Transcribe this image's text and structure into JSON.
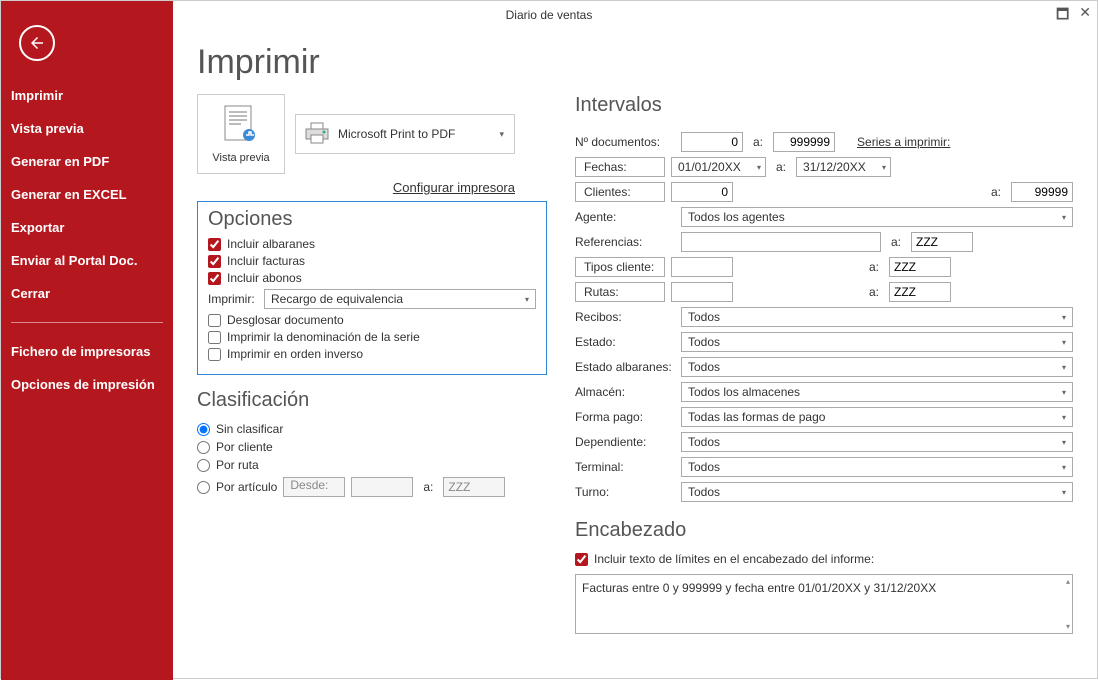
{
  "titlebar": {
    "title": "Diario de ventas"
  },
  "sidebar": {
    "items": [
      "Imprimir",
      "Vista previa",
      "Generar en PDF",
      "Generar en EXCEL",
      "Exportar",
      "Enviar al Portal Doc.",
      "Cerrar"
    ],
    "items2": [
      "Fichero de impresoras",
      "Opciones de impresión"
    ]
  },
  "page": {
    "title": "Imprimir",
    "preview_label": "Vista previa",
    "printer_name": "Microsoft Print to PDF",
    "configure_link": "Configurar impresora"
  },
  "options": {
    "title": "Opciones",
    "include_delivery": "Incluir albaranes",
    "include_invoices": "Incluir facturas",
    "include_credits": "Incluir abonos",
    "print_label": "Imprimir:",
    "print_mode": "Recargo de equivalencia",
    "breakdown_doc": "Desglosar documento",
    "print_series_name": "Imprimir la denominación de la serie",
    "reverse_order": "Imprimir en orden inverso"
  },
  "classification": {
    "title": "Clasificación",
    "unsorted": "Sin clasificar",
    "by_client": "Por cliente",
    "by_route": "Por ruta",
    "by_article": "Por artículo",
    "from_label": "Desde:",
    "from_value": "",
    "to_label": "a:",
    "to_value": "ZZZ"
  },
  "intervals": {
    "title": "Intervalos",
    "docnum_label": "Nº documentos:",
    "docnum_from": "0",
    "docnum_to": "999999",
    "series_link": "Series a imprimir:",
    "dates_btn": "Fechas:",
    "date_from": "01/01/20XX",
    "date_to": "31/12/20XX",
    "clients_btn": "Clientes:",
    "clients_from": "0",
    "clients_to": "99999",
    "agent_label": "Agente:",
    "agent_value": "Todos los agentes",
    "refs_label": "Referencias:",
    "refs_from": "",
    "refs_to": "ZZZ",
    "client_types_btn": "Tipos cliente:",
    "client_types_from": "",
    "client_types_to": "ZZZ",
    "routes_btn": "Rutas:",
    "routes_from": "",
    "routes_to": "ZZZ",
    "receipts_label": "Recibos:",
    "receipts_value": "Todos",
    "state_label": "Estado:",
    "state_value": "Todos",
    "delivery_state_label": "Estado albaranes:",
    "delivery_state_value": "Todos",
    "warehouse_label": "Almacén:",
    "warehouse_value": "Todos los almacenes",
    "payment_label": "Forma pago:",
    "payment_value": "Todas las formas de pago",
    "clerk_label": "Dependiente:",
    "clerk_value": "Todos",
    "terminal_label": "Terminal:",
    "terminal_value": "Todos",
    "shift_label": "Turno:",
    "shift_value": "Todos",
    "a": "a:"
  },
  "header": {
    "title": "Encabezado",
    "include_limits": "Incluir texto de límites en el encabezado del informe:",
    "text": "Facturas entre 0 y 999999 y fecha entre 01/01/20XX y 31/12/20XX"
  }
}
